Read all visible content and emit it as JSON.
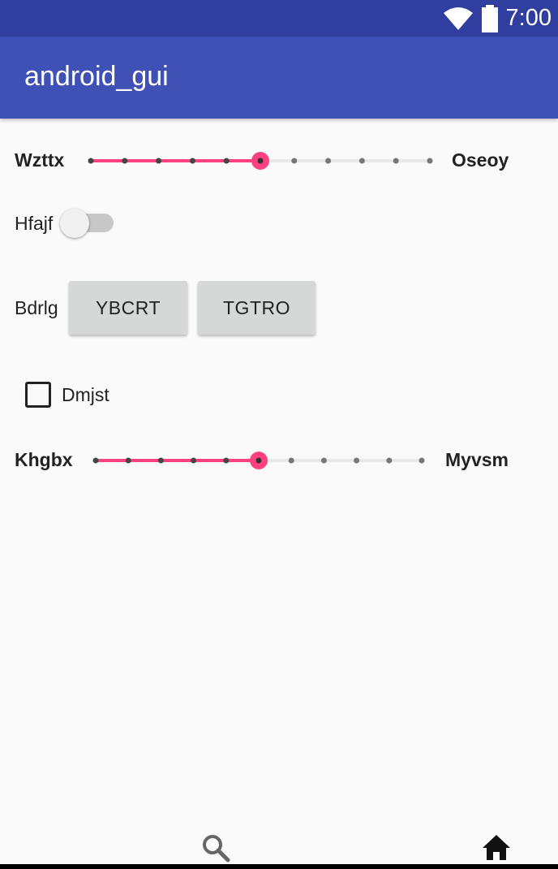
{
  "status_bar": {
    "time": "7:00",
    "icons": [
      "wifi-icon",
      "battery-icon"
    ],
    "color": "#303f9f"
  },
  "app_bar": {
    "title": "android_gui",
    "color": "#3f51b5"
  },
  "seekbar_1": {
    "left_label": "Wzttx",
    "right_label": "Oseoy",
    "steps": 10,
    "value": 5,
    "accent": "#ff4081"
  },
  "switch_row": {
    "label": "Hfajf",
    "checked": false
  },
  "button_row": {
    "label": "Bdrlg",
    "buttons": [
      "YBCRT",
      "TGTRO"
    ]
  },
  "checkbox_row": {
    "label": "Dmjst",
    "checked": false
  },
  "seekbar_2": {
    "left_label": "Khgbx",
    "right_label": "Myvsm",
    "steps": 10,
    "value": 5,
    "accent": "#ff4081"
  },
  "bottom_nav": {
    "items": [
      "search-icon",
      "home-icon"
    ]
  }
}
